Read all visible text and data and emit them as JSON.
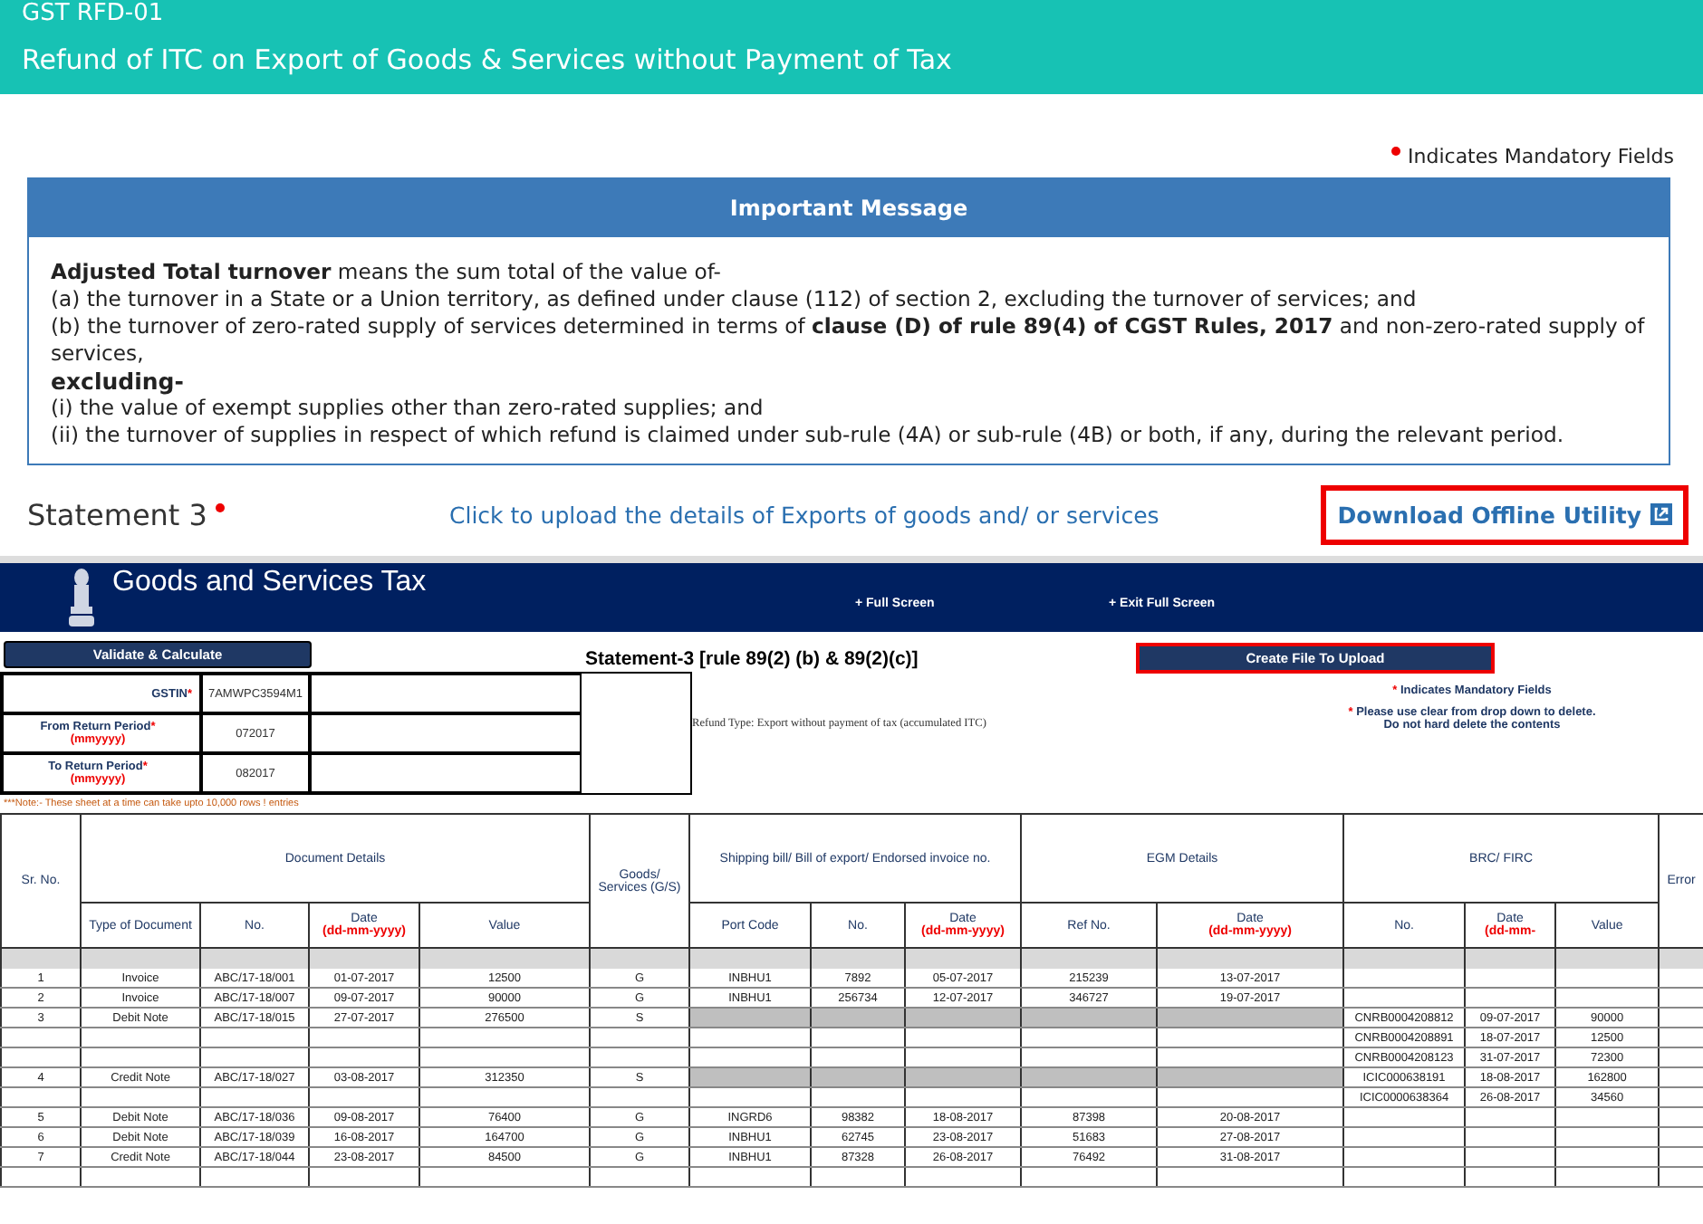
{
  "header": {
    "form": "GST RFD-01",
    "title": "Refund of ITC on Export of Goods & Services without Payment of Tax"
  },
  "mandatory_note": "Indicates Mandatory Fields",
  "message": {
    "title": "Important Message",
    "lines": [
      {
        "text": "**Adjusted Total turnover** means the sum total of the value of-",
        "bold": false
      },
      {
        "text": "(a) the turnover in a State or a Union territory, as defined under clause (112) of section 2, excluding the turnover of services; and",
        "bold": false
      },
      {
        "text": "(b) the turnover of zero-rated supply of services determined in terms of **clause (D) of rule 89(4) of CGST Rules, 2017** and non-zero-rated supply of services,",
        "bold": false
      },
      {
        "text": "excluding-",
        "bold": true
      },
      {
        "text": "(i) the value of exempt supplies other than zero-rated supplies; and",
        "bold": false
      },
      {
        "text": "(ii) the turnover of supplies in respect of which refund is claimed under sub-rule (4A) or sub-rule (4B) or both, if any, during the relevant period.",
        "bold": false
      }
    ]
  },
  "statement": {
    "label": "Statement 3",
    "required": true,
    "upload_link": "Click to upload the details of Exports of goods and/ or services",
    "download_button": "Download Offline Utility"
  },
  "sheet": {
    "banner": {
      "title": "Goods and Services Tax",
      "full_screen": "+ Full Screen",
      "exit_full_screen": "+ Exit Full Screen"
    },
    "validate_button": "Validate & Calculate",
    "heading": "Statement-3 [rule 89(2) (b) & 89(2)(c)]",
    "create_button": "Create File To Upload",
    "fields": [
      {
        "label": "GSTIN",
        "marker": "*",
        "value": "7AMWPC3594M1"
      },
      {
        "label": "From Return Period",
        "marker": "*",
        "hint": "(mmyyyy)",
        "value": "072017"
      },
      {
        "label": "To Return Period",
        "marker": "*",
        "hint": "(mmyyyy)",
        "value": "082017"
      }
    ],
    "refund_type": "Refund Type: Export without payment of tax (accumulated ITC)",
    "mandatory_note": {
      "marker": "*",
      "text": "Indicates Mandatory Fields"
    },
    "delete_note": {
      "marker": "*",
      "lines": [
        "Please use clear from drop down to delete.",
        "Do not hard delete the contents"
      ]
    },
    "row_note": "***Note:- These sheet at a time can take upto 10,000 rows ! entries",
    "columns": [
      {
        "label": "Sr. No."
      },
      {
        "label": "Document Details",
        "children": [
          {
            "label": "Type of Document"
          },
          {
            "label": "No."
          },
          {
            "label": "Date",
            "hint": "(dd-mm-yyyy)"
          },
          {
            "label": "Value"
          }
        ]
      },
      {
        "label": "Goods/ Services (G/S)"
      },
      {
        "label": "Shipping bill/ Bill of export/ Endorsed invoice no.",
        "children": [
          {
            "label": "Port Code"
          },
          {
            "label": "No."
          },
          {
            "label": "Date",
            "hint": "(dd-mm-yyyy)"
          }
        ]
      },
      {
        "label": "EGM Details",
        "children": [
          {
            "label": "Ref No."
          },
          {
            "label": "Date",
            "hint": "(dd-mm-yyyy)"
          }
        ]
      },
      {
        "label": "BRC/ FIRC",
        "children": [
          {
            "label": "No."
          },
          {
            "label": "Date",
            "hint": "(dd-mm-"
          },
          {
            "label": "Value"
          }
        ]
      },
      {
        "label": "Error"
      }
    ],
    "rows": [
      {
        "sr": "1",
        "doc_type": "Invoice",
        "doc_no": "ABC/17-18/001",
        "doc_date": "01-07-2017",
        "doc_value": "12500",
        "gs": "G",
        "port": "INBHU1",
        "ship_no": "7892",
        "ship_date": "05-07-2017",
        "egm_ref": "215239",
        "egm_date": "13-07-2017",
        "shaded": false
      },
      {
        "sr": "2",
        "doc_type": "Invoice",
        "doc_no": "ABC/17-18/007",
        "doc_date": "09-07-2017",
        "doc_value": "90000",
        "gs": "G",
        "port": "INBHU1",
        "ship_no": "256734",
        "ship_date": "12-07-2017",
        "egm_ref": "346727",
        "egm_date": "19-07-2017",
        "shaded": false
      },
      {
        "sr": "3",
        "doc_type": "Debit Note",
        "doc_no": "ABC/17-18/015",
        "doc_date": "27-07-2017",
        "doc_value": "276500",
        "gs": "S",
        "brc_no": "CNRB0004208812",
        "brc_date": "09-07-2017",
        "brc_value": "90000",
        "shaded": true
      },
      {
        "brc_no": "CNRB0004208891",
        "brc_date": "18-07-2017",
        "brc_value": "12500",
        "shaded": false
      },
      {
        "brc_no": "CNRB0004208123",
        "brc_date": "31-07-2017",
        "brc_value": "72300",
        "shaded": false
      },
      {
        "sr": "4",
        "doc_type": "Credit Note",
        "doc_no": "ABC/17-18/027",
        "doc_date": "03-08-2017",
        "doc_value": "312350",
        "gs": "S",
        "brc_no": "ICIC000638191",
        "brc_date": "18-08-2017",
        "brc_value": "162800",
        "shaded": true
      },
      {
        "brc_no": "ICIC0000638364",
        "brc_date": "26-08-2017",
        "brc_value": "34560",
        "shaded": false
      },
      {
        "sr": "5",
        "doc_type": "Debit Note",
        "doc_no": "ABC/17-18/036",
        "doc_date": "09-08-2017",
        "doc_value": "76400",
        "gs": "G",
        "port": "INGRD6",
        "ship_no": "98382",
        "ship_date": "18-08-2017",
        "egm_ref": "87398",
        "egm_date": "20-08-2017",
        "shaded": false
      },
      {
        "sr": "6",
        "doc_type": "Debit Note",
        "doc_no": "ABC/17-18/039",
        "doc_date": "16-08-2017",
        "doc_value": "164700",
        "gs": "G",
        "port": "INBHU1",
        "ship_no": "62745",
        "ship_date": "23-08-2017",
        "egm_ref": "51683",
        "egm_date": "27-08-2017",
        "shaded": false
      },
      {
        "sr": "7",
        "doc_type": "Credit Note",
        "doc_no": "ABC/17-18/044",
        "doc_date": "23-08-2017",
        "doc_value": "84500",
        "gs": "G",
        "port": "INBHU1",
        "ship_no": "87328",
        "ship_date": "26-08-2017",
        "egm_ref": "76492",
        "egm_date": "31-08-2017",
        "shaded": false
      },
      {
        "shaded": false
      }
    ]
  }
}
